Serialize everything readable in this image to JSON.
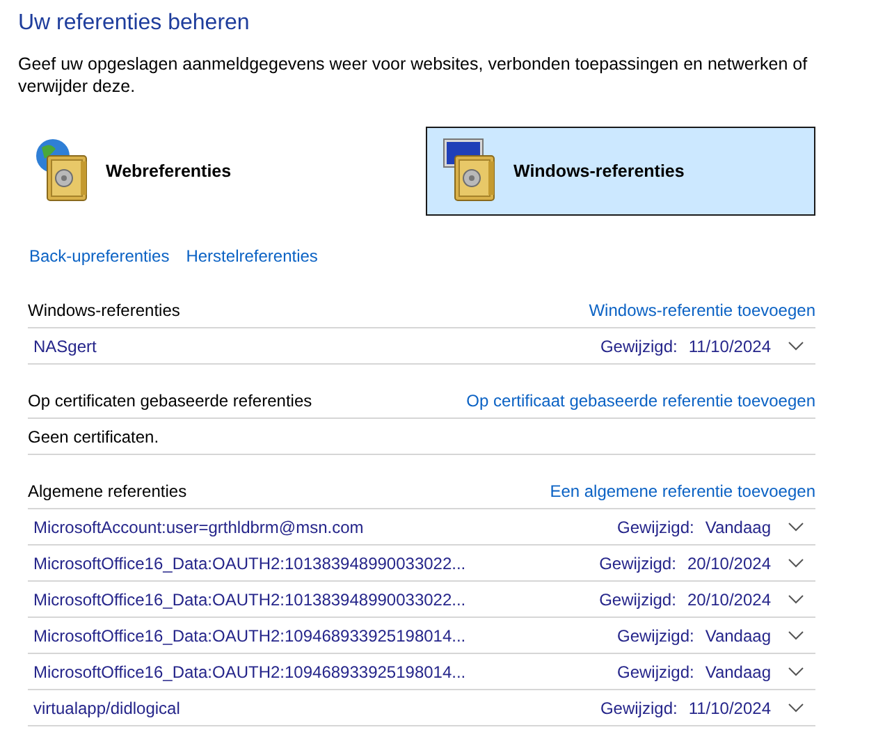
{
  "title": "Uw referenties beheren",
  "description": "Geef uw opgeslagen aanmeldgegevens weer voor websites, verbonden toepassingen en netwerken of verwijder deze.",
  "vault_tabs": [
    {
      "label": "Webreferenties",
      "kind": "web",
      "selected": false
    },
    {
      "label": "Windows-referenties",
      "kind": "windows",
      "selected": true
    }
  ],
  "links": [
    "Back-upreferenties",
    "Herstelreferenties"
  ],
  "sections": [
    {
      "title": "Windows-referenties",
      "add_link": "Windows-referentie toevoegen",
      "items": [
        {
          "name": "NASgert",
          "modified_label": "Gewijzigd:",
          "modified": "11/10/2024",
          "expanded": false
        }
      ]
    },
    {
      "title": "Op certificaten gebaseerde referenties",
      "add_link": "Op certificaat gebaseerde referentie toevoegen",
      "empty_text": "Geen certificaten."
    },
    {
      "title": "Algemene referenties",
      "add_link": "Een algemene referentie toevoegen",
      "items": [
        {
          "name": "MicrosoftAccount:user=grthldbrm@msn.com",
          "modified_label": "Gewijzigd:",
          "modified": "Vandaag",
          "expanded": false
        },
        {
          "name": "MicrosoftOffice16_Data:OAUTH2:101383948990033022...",
          "modified_label": "Gewijzigd:",
          "modified": "20/10/2024",
          "expanded": false
        },
        {
          "name": "MicrosoftOffice16_Data:OAUTH2:101383948990033022...",
          "modified_label": "Gewijzigd:",
          "modified": "20/10/2024",
          "expanded": false
        },
        {
          "name": "MicrosoftOffice16_Data:OAUTH2:109468933925198014...",
          "modified_label": "Gewijzigd:",
          "modified": "Vandaag",
          "expanded": false
        },
        {
          "name": "MicrosoftOffice16_Data:OAUTH2:109468933925198014...",
          "modified_label": "Gewijzigd:",
          "modified": "Vandaag",
          "expanded": false
        },
        {
          "name": "virtualapp/didlogical",
          "modified_label": "Gewijzigd:",
          "modified": "11/10/2024",
          "expanded": false
        }
      ]
    }
  ]
}
